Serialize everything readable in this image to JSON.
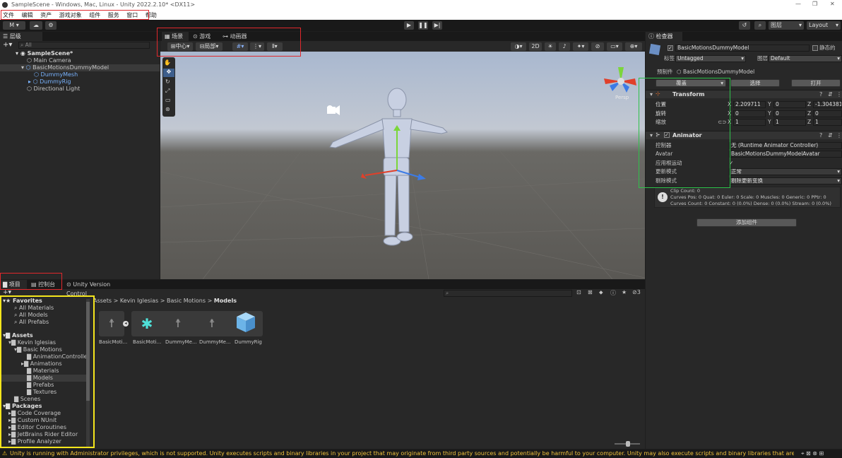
{
  "window": {
    "title": "SampleScene - Windows, Mac, Linux - Unity 2022.2.10* <DX11>",
    "controls": [
      "—",
      "❐",
      "✕"
    ]
  },
  "menu": [
    "文件",
    "编辑",
    "资产",
    "游戏对象",
    "组件",
    "服务",
    "窗口",
    "帮助"
  ],
  "toolbar": {
    "account": "M",
    "layers": "图层",
    "layout": "Layout"
  },
  "hierarchy": {
    "tab": "层级",
    "search_placeholder": "All",
    "items": [
      {
        "label": "SampleScene*",
        "icon": "unity-scene-icon"
      },
      {
        "label": "Main Camera",
        "icon": "gameobject-icon"
      },
      {
        "label": "BasicMotionsDummyModel",
        "icon": "prefab-icon"
      },
      {
        "label": "DummyMesh",
        "icon": "prefab-icon"
      },
      {
        "label": "DummyRig",
        "icon": "prefab-icon"
      },
      {
        "label": "Directional Light",
        "icon": "gameobject-icon"
      }
    ]
  },
  "scene": {
    "tabs": [
      "场景",
      "游戏",
      "动画器"
    ],
    "pivot": "中心",
    "local": "局部",
    "mode2d": "2D",
    "persp": "Persp"
  },
  "project": {
    "tabs": [
      "项目",
      "控制台"
    ],
    "vc_tab": "Unity Version Control",
    "breadcrumb": [
      "Assets",
      "Kevin Iglesias",
      "Basic Motions",
      "Models"
    ],
    "badge": "3",
    "tree": [
      {
        "label": "Favorites",
        "bold": true
      },
      {
        "label": "All Materials"
      },
      {
        "label": "All Models"
      },
      {
        "label": "All Prefabs"
      },
      {
        "label": "Assets",
        "bold": true
      },
      {
        "label": "Kevin Iglesias"
      },
      {
        "label": "Basic Motions"
      },
      {
        "label": "AnimationController"
      },
      {
        "label": "Animations"
      },
      {
        "label": "Materials"
      },
      {
        "label": "Models"
      },
      {
        "label": "Prefabs"
      },
      {
        "label": "Textures"
      },
      {
        "label": "Scenes"
      },
      {
        "label": "Packages",
        "bold": true
      },
      {
        "label": "Code Coverage"
      },
      {
        "label": "Custom NUnit"
      },
      {
        "label": "Editor Coroutines"
      },
      {
        "label": "JetBrains Rider Editor"
      },
      {
        "label": "Profile Analyzer"
      }
    ],
    "assets": [
      "BasicMoti...",
      "BasicMoti...",
      "DummyMe...",
      "DummyMe...",
      "DummyRig"
    ]
  },
  "inspector": {
    "tab": "检查器",
    "name": "BasicMotionsDummyModel",
    "static": "静态的",
    "tag_label": "标签",
    "tag": "Untagged",
    "layer_label": "图层",
    "layer": "Default",
    "prefab_label": "预制件",
    "prefab": "BasicMotionsDummyModel",
    "overrides": "覆盖",
    "select": "选择",
    "open": "打开",
    "transform": {
      "title": "Transform",
      "rows": [
        {
          "label": "位置",
          "x": "2.209711",
          "y": "0",
          "z": "-1.304381"
        },
        {
          "label": "旋转",
          "x": "0",
          "y": "0",
          "z": "0"
        },
        {
          "label": "缩放",
          "x": "1",
          "y": "1",
          "z": "1"
        }
      ]
    },
    "animator": {
      "title": "Animator",
      "rows": [
        {
          "label": "控制器",
          "value": "无 (Runtime Animator Controller)"
        },
        {
          "label": "Avatar",
          "value": "BasicMotionsDummyModelAvatar"
        },
        {
          "label": "应用根运动",
          "value": "✓"
        },
        {
          "label": "更新模式",
          "value": "正常"
        },
        {
          "label": "剔除模式",
          "value": "剔除更新变换"
        }
      ],
      "info": [
        "Clip Count: 0",
        "Curves Pos: 0 Quat: 0 Euler: 0 Scale: 0 Muscles: 0 Generic: 0 PPtr: 0",
        "Curves Count: 0 Constant: 0 (0.0%) Dense: 0 (0.0%) Stream: 0 (0.0%)"
      ]
    },
    "add_component": "添加组件"
  },
  "status": "Unity is running with Administrator privileges, which is not supported. Unity executes scripts and binary libraries in your project that may originate from third party sources and potentially be harmful to your computer. Unity may also execute scripts and binary libraries that are still under development and"
}
